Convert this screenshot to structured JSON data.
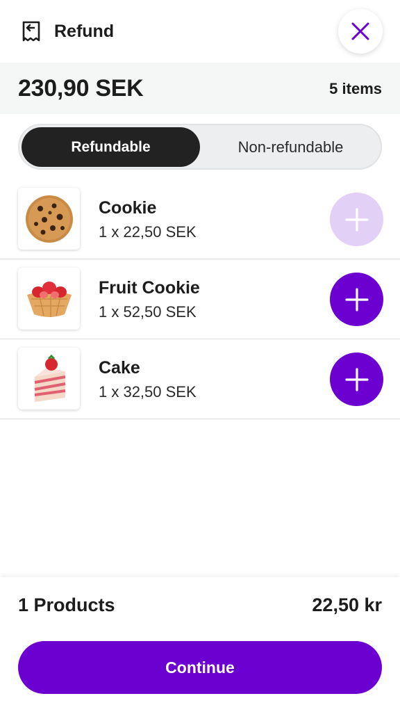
{
  "header": {
    "title": "Refund",
    "icon": "refund-icon",
    "close_icon": "close-icon"
  },
  "summary": {
    "total": "230,90 SEK",
    "items_count": "5 items"
  },
  "tabs": [
    {
      "label": "Refundable",
      "active": true
    },
    {
      "label": "Non-refundable",
      "active": false
    }
  ],
  "products": [
    {
      "name": "Cookie",
      "price": "1 x 22,50 SEK",
      "image": "cookie-image",
      "added": true
    },
    {
      "name": "Fruit Cookie",
      "price": "1 x 52,50 SEK",
      "image": "fruit-cookie-image",
      "added": false
    },
    {
      "name": "Cake",
      "price": "1 x 32,50 SEK",
      "image": "cake-image",
      "added": false
    }
  ],
  "footer": {
    "products_label": "1 Products",
    "sum": "22,50 kr",
    "continue_label": "Continue"
  },
  "colors": {
    "accent": "#6c00d0",
    "accent_light": "#e2d0f6",
    "dark": "#222222"
  }
}
